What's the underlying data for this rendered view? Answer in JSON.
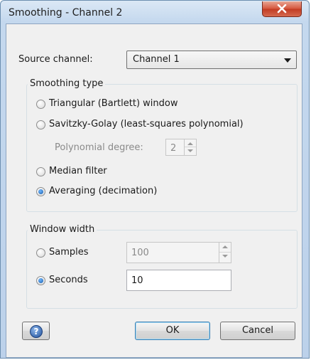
{
  "window": {
    "title": "Smoothing - Channel 2",
    "close_icon": "close-icon"
  },
  "source": {
    "label": "Source channel:",
    "selected": "Channel 1"
  },
  "smoothing_type": {
    "title": "Smoothing type",
    "options": [
      {
        "label": "Triangular (Bartlett) window",
        "checked": false
      },
      {
        "label": "Savitzky-Golay (least-squares polynomial)",
        "checked": false
      },
      {
        "label": "Median filter",
        "checked": false
      },
      {
        "label": "Averaging (decimation)",
        "checked": true
      }
    ],
    "polynomial_degree_label": "Polynomial degree:",
    "polynomial_degree_value": "2"
  },
  "window_width": {
    "title": "Window width",
    "samples_label": "Samples",
    "samples_value": "100",
    "samples_checked": false,
    "seconds_label": "Seconds",
    "seconds_value": "10",
    "seconds_checked": true
  },
  "buttons": {
    "help_glyph": "?",
    "ok": "OK",
    "cancel": "Cancel"
  }
}
